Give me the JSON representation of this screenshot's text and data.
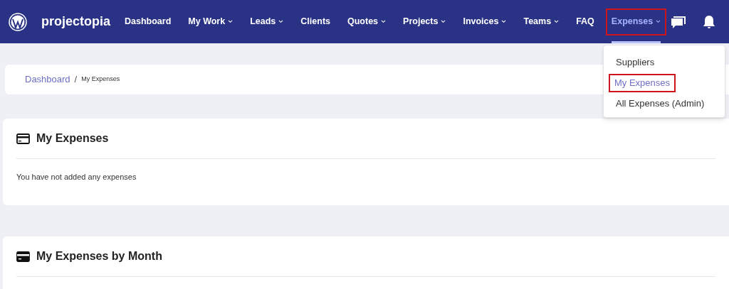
{
  "brand": "projectopia",
  "nav": [
    {
      "label": "Dashboard",
      "dropdown": false,
      "selected": false,
      "highlighted": false
    },
    {
      "label": "My Work",
      "dropdown": true,
      "selected": false,
      "highlighted": false
    },
    {
      "label": "Leads",
      "dropdown": true,
      "selected": false,
      "highlighted": false
    },
    {
      "label": "Clients",
      "dropdown": false,
      "selected": false,
      "highlighted": false
    },
    {
      "label": "Quotes",
      "dropdown": true,
      "selected": false,
      "highlighted": false
    },
    {
      "label": "Projects",
      "dropdown": true,
      "selected": false,
      "highlighted": false
    },
    {
      "label": "Invoices",
      "dropdown": true,
      "selected": false,
      "highlighted": false
    },
    {
      "label": "Teams",
      "dropdown": true,
      "selected": false,
      "highlighted": false
    },
    {
      "label": "FAQ",
      "dropdown": false,
      "selected": false,
      "highlighted": false
    },
    {
      "label": "Expenses",
      "dropdown": true,
      "selected": true,
      "highlighted": true
    }
  ],
  "dropdown_menu": [
    {
      "label": "Suppliers",
      "selected": false,
      "highlighted": false
    },
    {
      "label": "My Expenses",
      "selected": true,
      "highlighted": true
    },
    {
      "label": "All Expenses (Admin)",
      "selected": false,
      "highlighted": false
    }
  ],
  "breadcrumb": {
    "link": "Dashboard",
    "separator": "/",
    "current": "My Expenses"
  },
  "panels": [
    {
      "title": "My Expenses",
      "body": "You have not added any expenses"
    },
    {
      "title": "My Expenses by Month"
    }
  ]
}
